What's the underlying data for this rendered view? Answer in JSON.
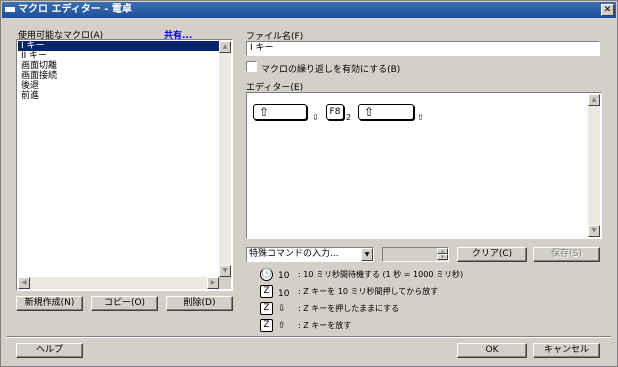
{
  "window": {
    "title": "マクロ エディター - 電卓",
    "close_glyph": "✕"
  },
  "left": {
    "list_label": "使用可能なマクロ(A)",
    "share_link": "共有...",
    "macros": [
      "I キー",
      "II キー",
      "画面切離",
      "画面接続",
      "後退",
      "前進"
    ],
    "selected_index": 0,
    "new_button": "新規作成(N)",
    "copy_button": "コピー(O)",
    "delete_button": "削除(D)"
  },
  "right": {
    "filename_label": "ファイル名(F)",
    "filename_value": "I キー",
    "repeat_checkbox_label": "マクロの繰り返しを有効にする(B)",
    "repeat_checked": false,
    "editor_label": "エディター(E)",
    "editor_keys": [
      {
        "icon": "shift-up-arrow",
        "glyph": "⇧",
        "suffix": "⇩"
      },
      {
        "icon": "f8-key",
        "label": "F8",
        "suffix": "2"
      },
      {
        "icon": "shift-up-arrow",
        "glyph": "⇧",
        "suffix": "⇧"
      }
    ],
    "special_command_placeholder": "特殊コマンドの入力...",
    "clear_button": "クリア(C)",
    "save_button": "保存(S)"
  },
  "legend": [
    {
      "icon": "clock-icon",
      "glyph": "🕓",
      "sub": "10",
      "text": ": 10 ミリ秒間待機する (1 秒 = 1000 ミリ秒)"
    },
    {
      "icon": "z-key-icon",
      "glyph": "Z",
      "sub": "10",
      "text": ": Z キーを 10 ミリ秒間押してから放す"
    },
    {
      "icon": "z-key-icon",
      "glyph": "Z",
      "sub": "⇩",
      "text": ": Z キーを押したままにする"
    },
    {
      "icon": "z-key-icon",
      "glyph": "Z",
      "sub": "⇧",
      "text": ": Z キーを放す"
    }
  ],
  "footer": {
    "help_button": "ヘルプ",
    "ok_button": "OK",
    "cancel_button": "キャンセル"
  }
}
